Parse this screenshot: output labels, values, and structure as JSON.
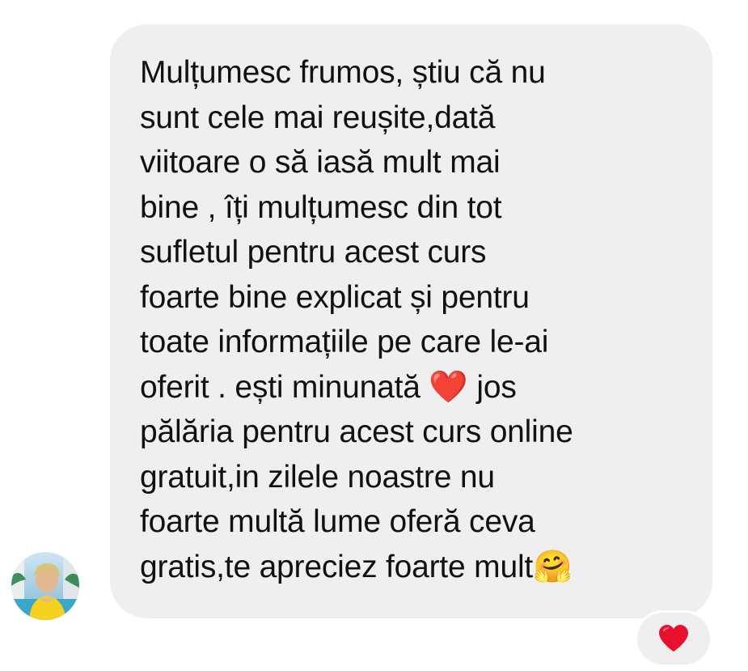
{
  "conversation": {
    "message": {
      "lines": [
        "Mulțumesc frumos, știu că nu",
        "sunt cele mai reușite,dată",
        "viitoare o să iasă mult mai",
        "bine , îți mulțumesc din tot",
        "sufletul pentru acest curs",
        "foarte bine explicat și pentru",
        "toate informațiile pe care le-ai",
        "oferit . ești minunată ❤️ jos",
        "pălăria pentru acest curs online",
        "gratuit,in zilele noastre nu",
        "foarte multă lume oferă ceva",
        "gratis,te apreciez foarte mult🤗"
      ],
      "bubble_color": "#efefef",
      "text_color": "#111111"
    },
    "sender_avatar": {
      "icon": "profile-photo"
    },
    "reaction": {
      "icon": "red-heart-icon",
      "color": "#e8112d"
    }
  }
}
